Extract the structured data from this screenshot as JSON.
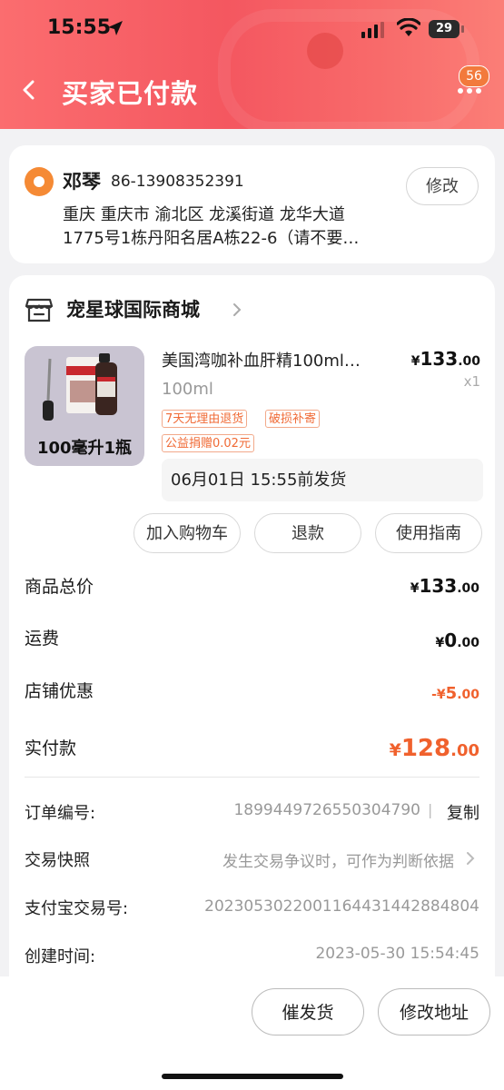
{
  "status": {
    "time": "15:55",
    "battery": "29"
  },
  "header": {
    "title": "买家已付款",
    "badge": "56"
  },
  "address": {
    "name": "邓琴",
    "phone": "86-13908352391",
    "edit_label": "修改",
    "line1": "重庆 重庆市 渝北区 龙溪街道 龙华大道",
    "line2": "1775号1栋丹阳名居A栋22-6（请不要…"
  },
  "shop": {
    "name": "宠星球国际商城"
  },
  "product": {
    "title": "美国湾咖补血肝精100ml…",
    "price_symbol": "¥",
    "price_int": "133",
    "price_dec": ".00",
    "qty": "x1",
    "spec": "100ml",
    "image_caption": "100毫升1瓶",
    "tags": [
      "7天无理由退货",
      "破损补寄",
      "公益捐赠0.02元"
    ],
    "ship_note": "06月01日 15:55前发货"
  },
  "actions": [
    "加入购物车",
    "退款",
    "使用指南"
  ],
  "summary": {
    "goods_label": "商品总价",
    "goods_sym": "¥",
    "goods_int": "133",
    "goods_dec": ".00",
    "freight_label": "运费",
    "freight_sym": "¥",
    "freight_int": "0",
    "freight_dec": ".00",
    "discount_label": "店铺优惠",
    "discount_sym": "-¥",
    "discount_int": "5",
    "discount_dec": ".00",
    "paid_label": "实付款",
    "paid_sym": "¥",
    "paid_int": "128",
    "paid_dec": ".00"
  },
  "info": {
    "order_no_label": "订单编号:",
    "order_no": "1899449726550304790",
    "copy_label": "复制",
    "snapshot_label": "交易快照",
    "snapshot_value": "发生交易争议时，可作为判断依据",
    "alipay_label": "支付宝交易号:",
    "alipay_no": "2023053022001164431442884804",
    "created_label": "创建时间:",
    "created_value": "2023-05-30 15:54:45"
  },
  "bottom": {
    "urge": "催发货",
    "change_addr": "修改地址"
  }
}
